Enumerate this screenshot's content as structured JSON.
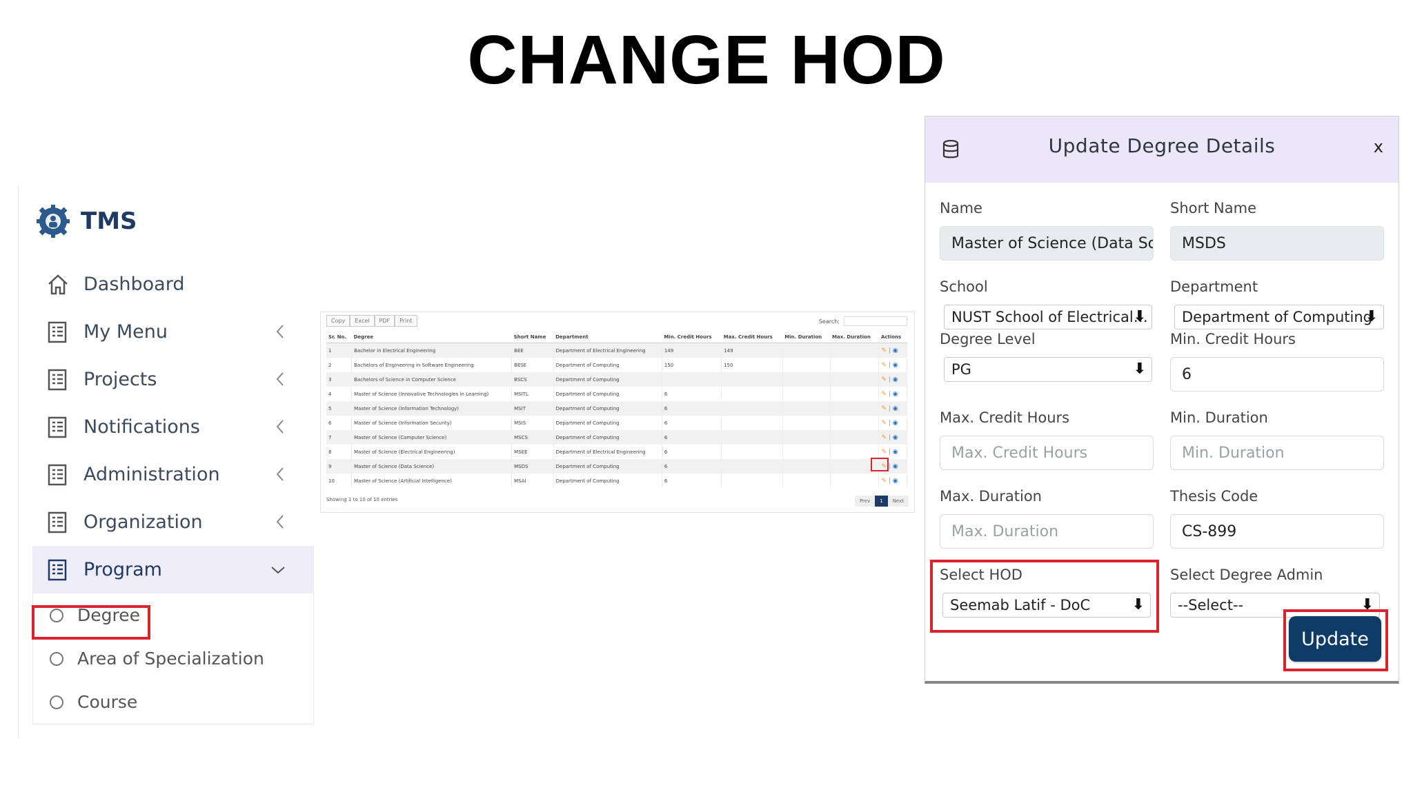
{
  "slide_title": "CHANGE HOD",
  "app": {
    "name": "TMS"
  },
  "sidebar": {
    "items": [
      {
        "label": "Dashboard",
        "icon": "home-icon"
      },
      {
        "label": "My Menu",
        "icon": "list-icon"
      },
      {
        "label": "Projects",
        "icon": "list-icon"
      },
      {
        "label": "Notifications",
        "icon": "list-icon"
      },
      {
        "label": "Administration",
        "icon": "list-icon"
      },
      {
        "label": "Organization",
        "icon": "list-icon"
      },
      {
        "label": "Program",
        "icon": "list-icon"
      }
    ],
    "sub_items": [
      {
        "label": "Degree"
      },
      {
        "label": "Area of Specialization"
      },
      {
        "label": "Course"
      }
    ]
  },
  "table": {
    "buttons": [
      "Copy",
      "Excel",
      "PDF",
      "Print"
    ],
    "search_label": "Search:",
    "headers": [
      "Sr. No.",
      "Degree",
      "Short Name",
      "Department",
      "Min. Credit Hours",
      "Max. Credit Hours",
      "Min. Duration",
      "Max. Duration",
      "Actions"
    ],
    "rows": [
      [
        "1",
        "Bachelor in Electrical Engineering",
        "BEE",
        "Department of Electrical Engineering",
        "149",
        "149",
        "",
        ""
      ],
      [
        "2",
        "Bachelors of Engineering in Software Engineering",
        "BESE",
        "Department of Computing",
        "150",
        "150",
        "",
        ""
      ],
      [
        "3",
        "Bachelors of Science in Computer Science",
        "BSCS",
        "Department of Computing",
        "",
        "",
        "",
        ""
      ],
      [
        "4",
        "Master of Science (Innovative Technologies in Learning)",
        "MSITL",
        "Department of Computing",
        "6",
        "",
        "",
        ""
      ],
      [
        "5",
        "Master of Science (Information Technology)",
        "MSIT",
        "Department of Computing",
        "6",
        "",
        "",
        ""
      ],
      [
        "6",
        "Master of Science (Information Security)",
        "MSIS",
        "Department of Computing",
        "6",
        "",
        "",
        ""
      ],
      [
        "7",
        "Master of Science (Computer Science)",
        "MSCS",
        "Department of Computing",
        "6",
        "",
        "",
        ""
      ],
      [
        "8",
        "Master of Science (Electrical Engineering)",
        "MSEE",
        "Department of Electrical Engineering",
        "6",
        "",
        "",
        ""
      ],
      [
        "9",
        "Master of Science (Data Science)",
        "MSDS",
        "Department of Computing",
        "6",
        "",
        "",
        ""
      ],
      [
        "10",
        "Master of Science (Artificial Intelligence)",
        "MSAI",
        "Department of Computing",
        "6",
        "",
        "",
        ""
      ]
    ],
    "footer": "Showing 1 to 10 of 10 entries",
    "pager": {
      "prev": "Prev",
      "current": "1",
      "next": "Next"
    }
  },
  "modal": {
    "title": "Update Degree Details",
    "close": "x",
    "fields": {
      "name": {
        "label": "Name",
        "value": "Master of Science (Data Sci"
      },
      "short_name": {
        "label": "Short Name",
        "value": "MSDS"
      },
      "school": {
        "label": "School",
        "value": "NUST School of Electrical…"
      },
      "department": {
        "label": "Department",
        "value": "Department of Computing"
      },
      "degree_level": {
        "label": "Degree Level",
        "value": "PG"
      },
      "min_credit": {
        "label": "Min. Credit Hours",
        "value": "6"
      },
      "max_credit": {
        "label": "Max. Credit Hours",
        "placeholder": "Max. Credit Hours"
      },
      "min_duration": {
        "label": "Min. Duration",
        "placeholder": "Min. Duration"
      },
      "max_duration": {
        "label": "Max. Duration",
        "placeholder": "Max. Duration"
      },
      "thesis_code": {
        "label": "Thesis Code",
        "value": "CS-899"
      },
      "hod": {
        "label": "Select HOD",
        "value": "Seemab Latif - DoC"
      },
      "degree_admin": {
        "label": "Select Degree Admin",
        "value": "--Select--"
      }
    },
    "update_button": "Update"
  },
  "colors": {
    "highlight": "#d9232d",
    "primary": "#0d3b66",
    "modal_header": "#ebe6f8",
    "active_menu": "#efedfa"
  }
}
